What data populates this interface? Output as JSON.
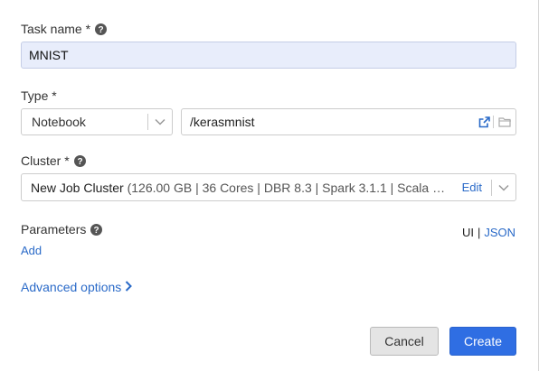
{
  "task": {
    "label": "Task name *",
    "value": "MNIST"
  },
  "type": {
    "label": "Type *",
    "selected": "Notebook",
    "path": "/kerasmnist"
  },
  "cluster": {
    "label": "Cluster *",
    "name": "New Job Cluster",
    "detail": " (126.00 GB | 36 Cores | DBR 8.3 | Spark 3.1.1 | Scala …",
    "edit_label": "Edit"
  },
  "parameters": {
    "label": "Parameters",
    "add_label": "Add",
    "mode_ui": "UI",
    "mode_separator": "|",
    "mode_json": "JSON"
  },
  "advanced": {
    "label": "Advanced options"
  },
  "footer": {
    "cancel_label": "Cancel",
    "create_label": "Create"
  },
  "colors": {
    "accent": "#2f6ee3",
    "link": "#2a6ac8",
    "task_input_bg": "#e8edfb"
  },
  "icons": [
    "help-icon",
    "chevron-down-icon",
    "external-link-icon",
    "folder-icon",
    "chevron-right-icon"
  ]
}
